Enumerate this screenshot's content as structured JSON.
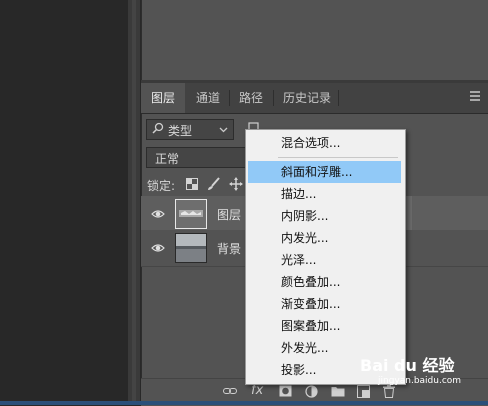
{
  "colors": {
    "panel": "#535353",
    "menu_bg": "#f0f0f0",
    "menu_highlight": "#91c9f7",
    "canvas": "#282828"
  },
  "tabs": [
    {
      "label": "图层",
      "active": true
    },
    {
      "label": "通道",
      "active": false
    },
    {
      "label": "路径",
      "active": false
    },
    {
      "label": "历史记录",
      "active": false
    }
  ],
  "filter": {
    "label": "类型",
    "icon": "search-icon"
  },
  "blend_mode": "正常",
  "lock_label": "锁定:",
  "layers": [
    {
      "name": "图层",
      "visible": true,
      "selected": true
    },
    {
      "name": "背景",
      "visible": true,
      "selected": false
    }
  ],
  "fx_menu": {
    "top_item": "混合选项...",
    "items": [
      {
        "label": "斜面和浮雕...",
        "highlighted": true
      },
      {
        "label": "描边...",
        "highlighted": false
      },
      {
        "label": "内阴影...",
        "highlighted": false
      },
      {
        "label": "内发光...",
        "highlighted": false
      },
      {
        "label": "光泽...",
        "highlighted": false
      },
      {
        "label": "颜色叠加...",
        "highlighted": false
      },
      {
        "label": "渐变叠加...",
        "highlighted": false
      },
      {
        "label": "图案叠加...",
        "highlighted": false
      },
      {
        "label": "外发光...",
        "highlighted": false
      },
      {
        "label": "投影...",
        "highlighted": false
      }
    ]
  },
  "bottom_bar": {
    "fx_label": "fx"
  },
  "watermark": {
    "text": "Bai du 经验",
    "sub": "jingyan.baidu.com"
  }
}
